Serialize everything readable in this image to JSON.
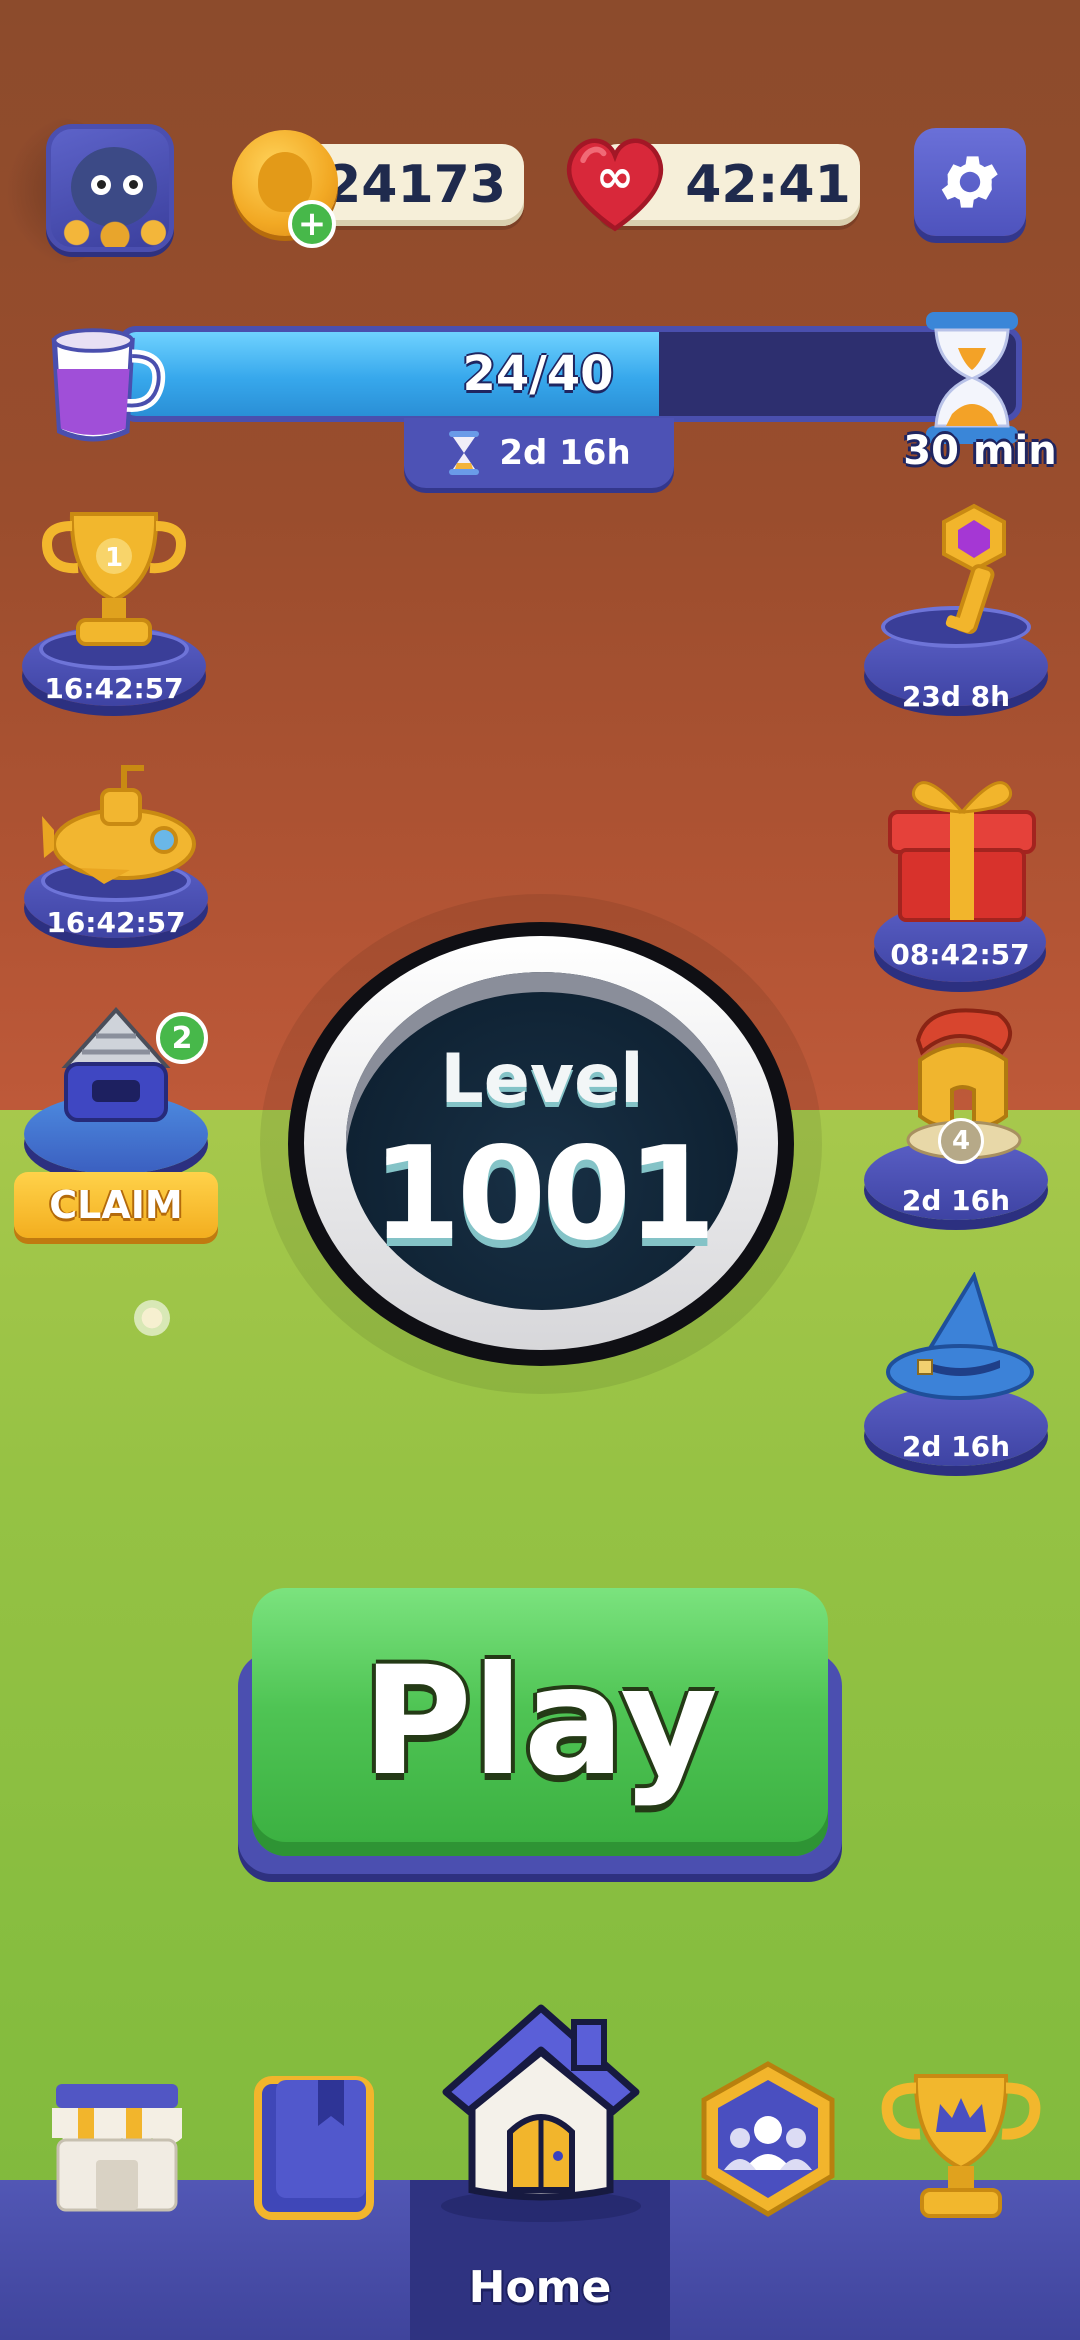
{
  "header": {
    "coins": "124173",
    "lives_symbol": "∞",
    "lives_timer": "42:41"
  },
  "progress": {
    "current_label": "24/40",
    "fraction": 0.6,
    "event_timer": "2d 16h",
    "bonus_timer": "30 min"
  },
  "left_events": [
    {
      "name": "trophy-event",
      "badge": "1",
      "timer": "16:42:57"
    },
    {
      "name": "submarine-event",
      "timer": "16:42:57"
    },
    {
      "name": "drill-event",
      "badge": "2",
      "action": "CLAIM"
    }
  ],
  "right_events": [
    {
      "name": "key-event",
      "timer": "23d 8h"
    },
    {
      "name": "gift-event",
      "timer": "08:42:57"
    },
    {
      "name": "helmet-event",
      "badge": "4",
      "timer": "2d 16h"
    },
    {
      "name": "wizard-hat-event",
      "timer": "2d 16h"
    }
  ],
  "level": {
    "label": "Level",
    "number": "1001"
  },
  "play_button": "Play",
  "bottom_nav": {
    "items": [
      {
        "icon": "shop-icon"
      },
      {
        "icon": "collection-book-icon"
      },
      {
        "icon": "home-icon",
        "label": "Home"
      },
      {
        "icon": "team-icon"
      },
      {
        "icon": "leaderboard-trophy-icon"
      }
    ]
  },
  "colors": {
    "play_green": "#4fc454",
    "nav_blue": "#4b4fb0",
    "progress_blue": "#37a8ec",
    "coin_gold": "#f2a924",
    "heart_red": "#d8283a"
  }
}
